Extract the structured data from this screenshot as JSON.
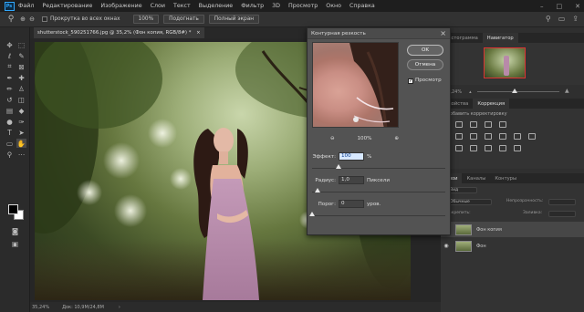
{
  "app": {
    "logo": "Ps"
  },
  "menu": [
    "Файл",
    "Редактирование",
    "Изображение",
    "Слои",
    "Текст",
    "Выделение",
    "Фильтр",
    "3D",
    "Просмотр",
    "Окно",
    "Справка"
  ],
  "window_controls": {
    "minimize": "–",
    "maximize": "□",
    "close": "✕"
  },
  "options_bar": {
    "scroll_all_label": "Прокрутка во всех окнах",
    "zoom_value": "100%",
    "fit_label": "Подогнать",
    "fullscreen_label": "Полный экран"
  },
  "document": {
    "tab_label": "shutterstock_590251766.jpg @ 35,2% (Фон копия, RGB/8#) *",
    "close": "×"
  },
  "status_bar": {
    "zoom": "35,24%",
    "doc_info": "Док: 10,9М/24,8М"
  },
  "panels": {
    "top_tabs": [
      "Гистограмма",
      "Навигатор"
    ],
    "navigator_zoom": "35,24%",
    "adjust_tabs": [
      "Свойства",
      "Коррекция"
    ],
    "adjust_hint": "Добавить корректировку",
    "layers_tabs": [
      "Слои",
      "Каналы",
      "Контуры"
    ],
    "layers_kind": "Вид",
    "blend_mode": "Обычные",
    "opacity_label": "Непрозрачность:",
    "lock_label": "Закрепить:",
    "fill_label": "Заливка:",
    "layers": [
      {
        "name": "Фон копия"
      },
      {
        "name": "Фон"
      }
    ]
  },
  "dialog": {
    "title": "Контурная резкость",
    "close": "×",
    "ok_label": "OK",
    "cancel_label": "Отмена",
    "preview_label": "Просмотр",
    "preview_checked": true,
    "zoom_out": "⊖",
    "zoom_value": "100%",
    "zoom_in": "⊕",
    "effect_label": "Эффект:",
    "effect_value": "100",
    "effect_unit": "%",
    "radius_label": "Радиус:",
    "radius_value": "1,0",
    "radius_unit": "Пиксели",
    "threshold_label": "Порог:",
    "threshold_value": "0",
    "threshold_unit": "уров.",
    "effect_level": 0.2,
    "radius_level": 0.04,
    "threshold_level": 0.0
  },
  "colors": {
    "accent": "#31a8ff",
    "input_highlight": "#d7e8ff",
    "chrome_dark": "#1e1e1e",
    "panel_bg": "#333333"
  }
}
